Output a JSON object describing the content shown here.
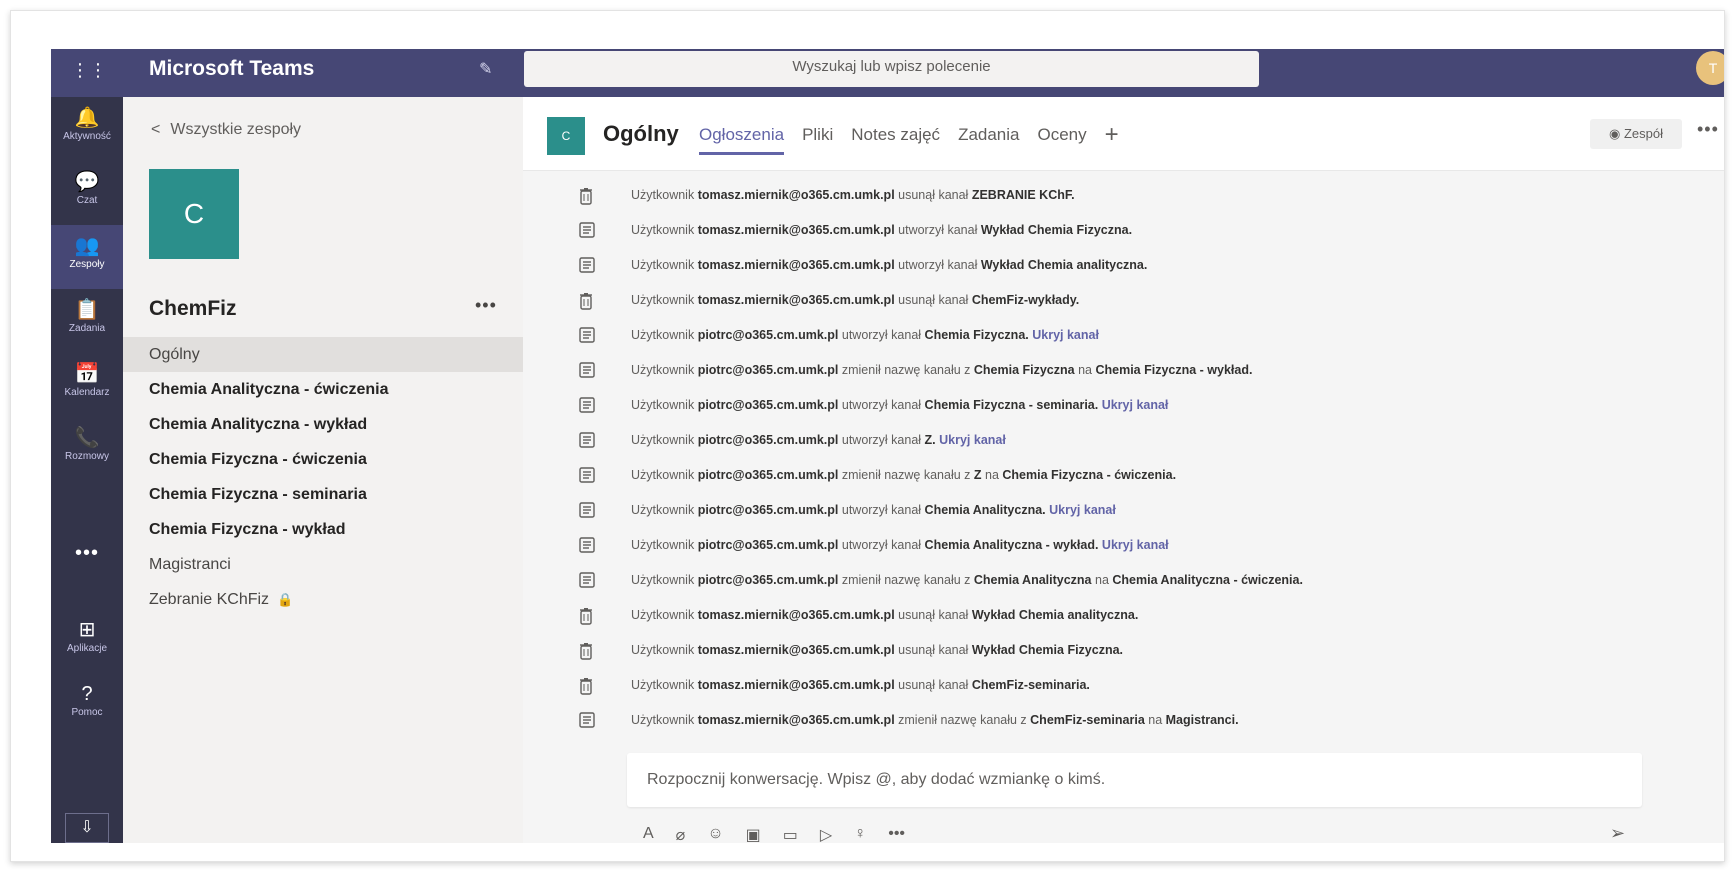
{
  "app": {
    "title": "Microsoft Teams",
    "user_initial": "T"
  },
  "search": {
    "placeholder": "Wyszukaj lub wpisz polecenie"
  },
  "rail": [
    {
      "label": "Aktywność",
      "icon": "bell-icon",
      "glyph": "🔔"
    },
    {
      "label": "Czat",
      "icon": "chat-icon",
      "glyph": "💬"
    },
    {
      "label": "Zespoły",
      "icon": "teams-icon",
      "glyph": "👥"
    },
    {
      "label": "Zadania",
      "icon": "assignments-icon",
      "glyph": "📋"
    },
    {
      "label": "Kalendarz",
      "icon": "calendar-icon",
      "glyph": "📅"
    },
    {
      "label": "Rozmowy",
      "icon": "phone-icon",
      "glyph": "📞"
    }
  ],
  "rail_bottom": [
    {
      "label": "Aplikacje",
      "icon": "apps-icon",
      "glyph": "⊞"
    },
    {
      "label": "Pomoc",
      "icon": "help-icon",
      "glyph": "?"
    }
  ],
  "team": {
    "back_label": "Wszystkie zespoły",
    "tile_letter": "C",
    "name": "ChemFiz",
    "channels": [
      {
        "label": "Ogólny",
        "bold": false,
        "active": true
      },
      {
        "label": "Chemia Analityczna - ćwiczenia",
        "bold": true
      },
      {
        "label": "Chemia Analityczna - wykład",
        "bold": true
      },
      {
        "label": "Chemia Fizyczna - ćwiczenia",
        "bold": true
      },
      {
        "label": "Chemia Fizyczna - seminaria",
        "bold": true
      },
      {
        "label": "Chemia Fizyczna - wykład",
        "bold": true
      },
      {
        "label": "Magistranci",
        "bold": false
      },
      {
        "label": "Zebranie KChFiz",
        "bold": false,
        "locked": true
      }
    ]
  },
  "channel_header": {
    "tile_letter": "C",
    "title": "Ogólny",
    "tabs": [
      "Ogłoszenia",
      "Pliki",
      "Notes zajęć",
      "Zadania",
      "Oceny"
    ],
    "team_button": "Zespół"
  },
  "feed": [
    {
      "icon": "trash",
      "segments": [
        [
          "n",
          "Użytkownik "
        ],
        [
          "b",
          "tomasz.miernik@o365.cm.umk.pl"
        ],
        [
          "n",
          " usunął kanał "
        ],
        [
          "b",
          "ZEBRANIE KChF."
        ]
      ]
    },
    {
      "icon": "channel",
      "segments": [
        [
          "n",
          "Użytkownik "
        ],
        [
          "b",
          "tomasz.miernik@o365.cm.umk.pl"
        ],
        [
          "n",
          " utworzył kanał "
        ],
        [
          "b",
          "Wykład Chemia Fizyczna."
        ]
      ]
    },
    {
      "icon": "channel",
      "segments": [
        [
          "n",
          "Użytkownik "
        ],
        [
          "b",
          "tomasz.miernik@o365.cm.umk.pl"
        ],
        [
          "n",
          " utworzył kanał "
        ],
        [
          "b",
          "Wykład Chemia analityczna."
        ]
      ]
    },
    {
      "icon": "trash",
      "segments": [
        [
          "n",
          "Użytkownik "
        ],
        [
          "b",
          "tomasz.miernik@o365.cm.umk.pl"
        ],
        [
          "n",
          " usunął kanał "
        ],
        [
          "b",
          "ChemFiz-wykłady."
        ]
      ]
    },
    {
      "icon": "channel",
      "segments": [
        [
          "n",
          "Użytkownik "
        ],
        [
          "b",
          "piotrc@o365.cm.umk.pl"
        ],
        [
          "n",
          " utworzył kanał "
        ],
        [
          "b",
          "Chemia Fizyczna. "
        ],
        [
          "l",
          "Ukryj kanał"
        ]
      ]
    },
    {
      "icon": "channel",
      "segments": [
        [
          "n",
          "Użytkownik "
        ],
        [
          "b",
          "piotrc@o365.cm.umk.pl"
        ],
        [
          "n",
          " zmienił nazwę kanału z "
        ],
        [
          "b",
          "Chemia Fizyczna"
        ],
        [
          "n",
          " na "
        ],
        [
          "b",
          "Chemia Fizyczna - wykład."
        ]
      ]
    },
    {
      "icon": "channel",
      "segments": [
        [
          "n",
          "Użytkownik "
        ],
        [
          "b",
          "piotrc@o365.cm.umk.pl"
        ],
        [
          "n",
          " utworzył kanał "
        ],
        [
          "b",
          "Chemia Fizyczna - seminaria. "
        ],
        [
          "l",
          "Ukryj kanał"
        ]
      ]
    },
    {
      "icon": "channel",
      "segments": [
        [
          "n",
          "Użytkownik "
        ],
        [
          "b",
          "piotrc@o365.cm.umk.pl"
        ],
        [
          "n",
          " utworzył kanał "
        ],
        [
          "b",
          "Z. "
        ],
        [
          "l",
          "Ukryj kanał"
        ]
      ]
    },
    {
      "icon": "channel",
      "segments": [
        [
          "n",
          "Użytkownik "
        ],
        [
          "b",
          "piotrc@o365.cm.umk.pl"
        ],
        [
          "n",
          " zmienił nazwę kanału z "
        ],
        [
          "b",
          "Z"
        ],
        [
          "n",
          " na "
        ],
        [
          "b",
          "Chemia Fizyczna - ćwiczenia."
        ]
      ]
    },
    {
      "icon": "channel",
      "segments": [
        [
          "n",
          "Użytkownik "
        ],
        [
          "b",
          "piotrc@o365.cm.umk.pl"
        ],
        [
          "n",
          " utworzył kanał "
        ],
        [
          "b",
          "Chemia Analityczna. "
        ],
        [
          "l",
          "Ukryj kanał"
        ]
      ]
    },
    {
      "icon": "channel",
      "segments": [
        [
          "n",
          "Użytkownik "
        ],
        [
          "b",
          "piotrc@o365.cm.umk.pl"
        ],
        [
          "n",
          " utworzył kanał "
        ],
        [
          "b",
          "Chemia Analityczna - wykład. "
        ],
        [
          "l",
          "Ukryj kanał"
        ]
      ]
    },
    {
      "icon": "channel",
      "segments": [
        [
          "n",
          "Użytkownik "
        ],
        [
          "b",
          "piotrc@o365.cm.umk.pl"
        ],
        [
          "n",
          " zmienił nazwę kanału z "
        ],
        [
          "b",
          "Chemia Analityczna"
        ],
        [
          "n",
          " na "
        ],
        [
          "b",
          "Chemia Analityczna - ćwiczenia."
        ]
      ]
    },
    {
      "icon": "trash",
      "segments": [
        [
          "n",
          "Użytkownik "
        ],
        [
          "b",
          "tomasz.miernik@o365.cm.umk.pl"
        ],
        [
          "n",
          " usunął kanał "
        ],
        [
          "b",
          "Wykład Chemia analityczna."
        ]
      ]
    },
    {
      "icon": "trash",
      "segments": [
        [
          "n",
          "Użytkownik "
        ],
        [
          "b",
          "tomasz.miernik@o365.cm.umk.pl"
        ],
        [
          "n",
          " usunął kanał "
        ],
        [
          "b",
          "Wykład Chemia Fizyczna."
        ]
      ]
    },
    {
      "icon": "trash",
      "segments": [
        [
          "n",
          "Użytkownik "
        ],
        [
          "b",
          "tomasz.miernik@o365.cm.umk.pl"
        ],
        [
          "n",
          " usunął kanał "
        ],
        [
          "b",
          "ChemFiz-seminaria."
        ]
      ]
    },
    {
      "icon": "channel",
      "segments": [
        [
          "n",
          "Użytkownik "
        ],
        [
          "b",
          "tomasz.miernik@o365.cm.umk.pl"
        ],
        [
          "n",
          " zmienił nazwę kanału z "
        ],
        [
          "b",
          "ChemFiz-seminaria"
        ],
        [
          "n",
          " na "
        ],
        [
          "b",
          "Magistranci."
        ]
      ]
    }
  ],
  "composer": {
    "placeholder": "Rozpocznij konwersację. Wpisz @, aby dodać wzmiankę o kimś."
  },
  "colors": {
    "brand": "#464775",
    "accent": "#6264a7",
    "rail": "#33344a",
    "team_tile": "#2b8f8b"
  }
}
